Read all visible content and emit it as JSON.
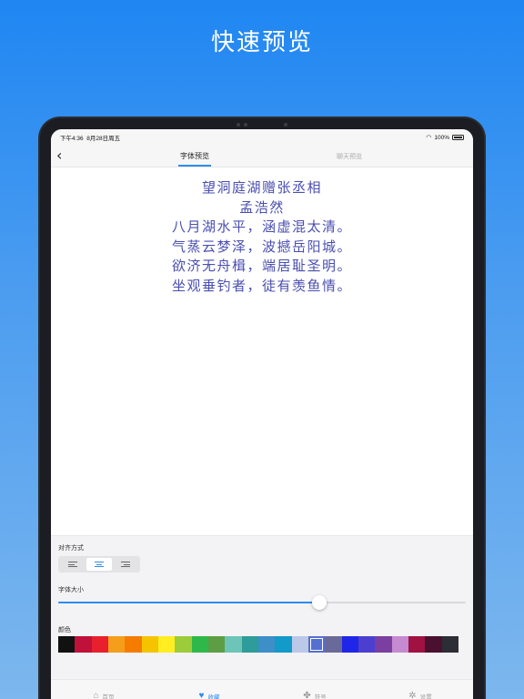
{
  "banner": {
    "title": "快速预览"
  },
  "statusbar": {
    "time": "下午4:36",
    "date": "8月28日周五",
    "battery": "100%"
  },
  "navbar": {
    "back_icon": "chevron-left-icon",
    "tabs": [
      {
        "label": "字体预览",
        "active": true
      },
      {
        "label": "聊天预览",
        "active": false
      }
    ]
  },
  "preview": {
    "text_color": "#4a4fb0",
    "lines": [
      "望洞庭湖赠张丞相",
      "孟浩然",
      "八月湖水平，涵虚混太清。",
      "气蒸云梦泽，波撼岳阳城。",
      "欲济无舟楫，端居耻圣明。",
      "坐观垂钓者，徒有羡鱼情。"
    ]
  },
  "panel": {
    "align_label": "对齐方式",
    "align_options": [
      {
        "name": "left",
        "icon": "align-left-icon"
      },
      {
        "name": "center",
        "icon": "align-center-icon",
        "active": true
      },
      {
        "name": "right",
        "icon": "align-right-icon"
      }
    ],
    "size_label": "字体大小",
    "size_value_fraction": 0.64,
    "color_label": "颜色",
    "colors": [
      "#111111",
      "#c0113a",
      "#e8202e",
      "#f59e1b",
      "#f57c00",
      "#f5c400",
      "#ffee22",
      "#9ccc3a",
      "#2fb84a",
      "#5d9e45",
      "#6cc5b8",
      "#2e9c9a",
      "#3c8fc7",
      "#129ac8",
      "#bcc8e8",
      "#5570d0",
      "#6a6a9a",
      "#2026e8",
      "#4b3fd0",
      "#7a3fa0",
      "#c58ad0",
      "#a01242",
      "#4a1030",
      "#2d2d35"
    ],
    "selected_color_index": 15
  },
  "tabbar": [
    {
      "label": "首页",
      "icon": "home-icon",
      "active": false
    },
    {
      "label": "收藏",
      "icon": "heart-icon",
      "active": true
    },
    {
      "label": "符号",
      "icon": "grid-icon",
      "active": false
    },
    {
      "label": "设置",
      "icon": "gear-icon",
      "active": false
    }
  ]
}
